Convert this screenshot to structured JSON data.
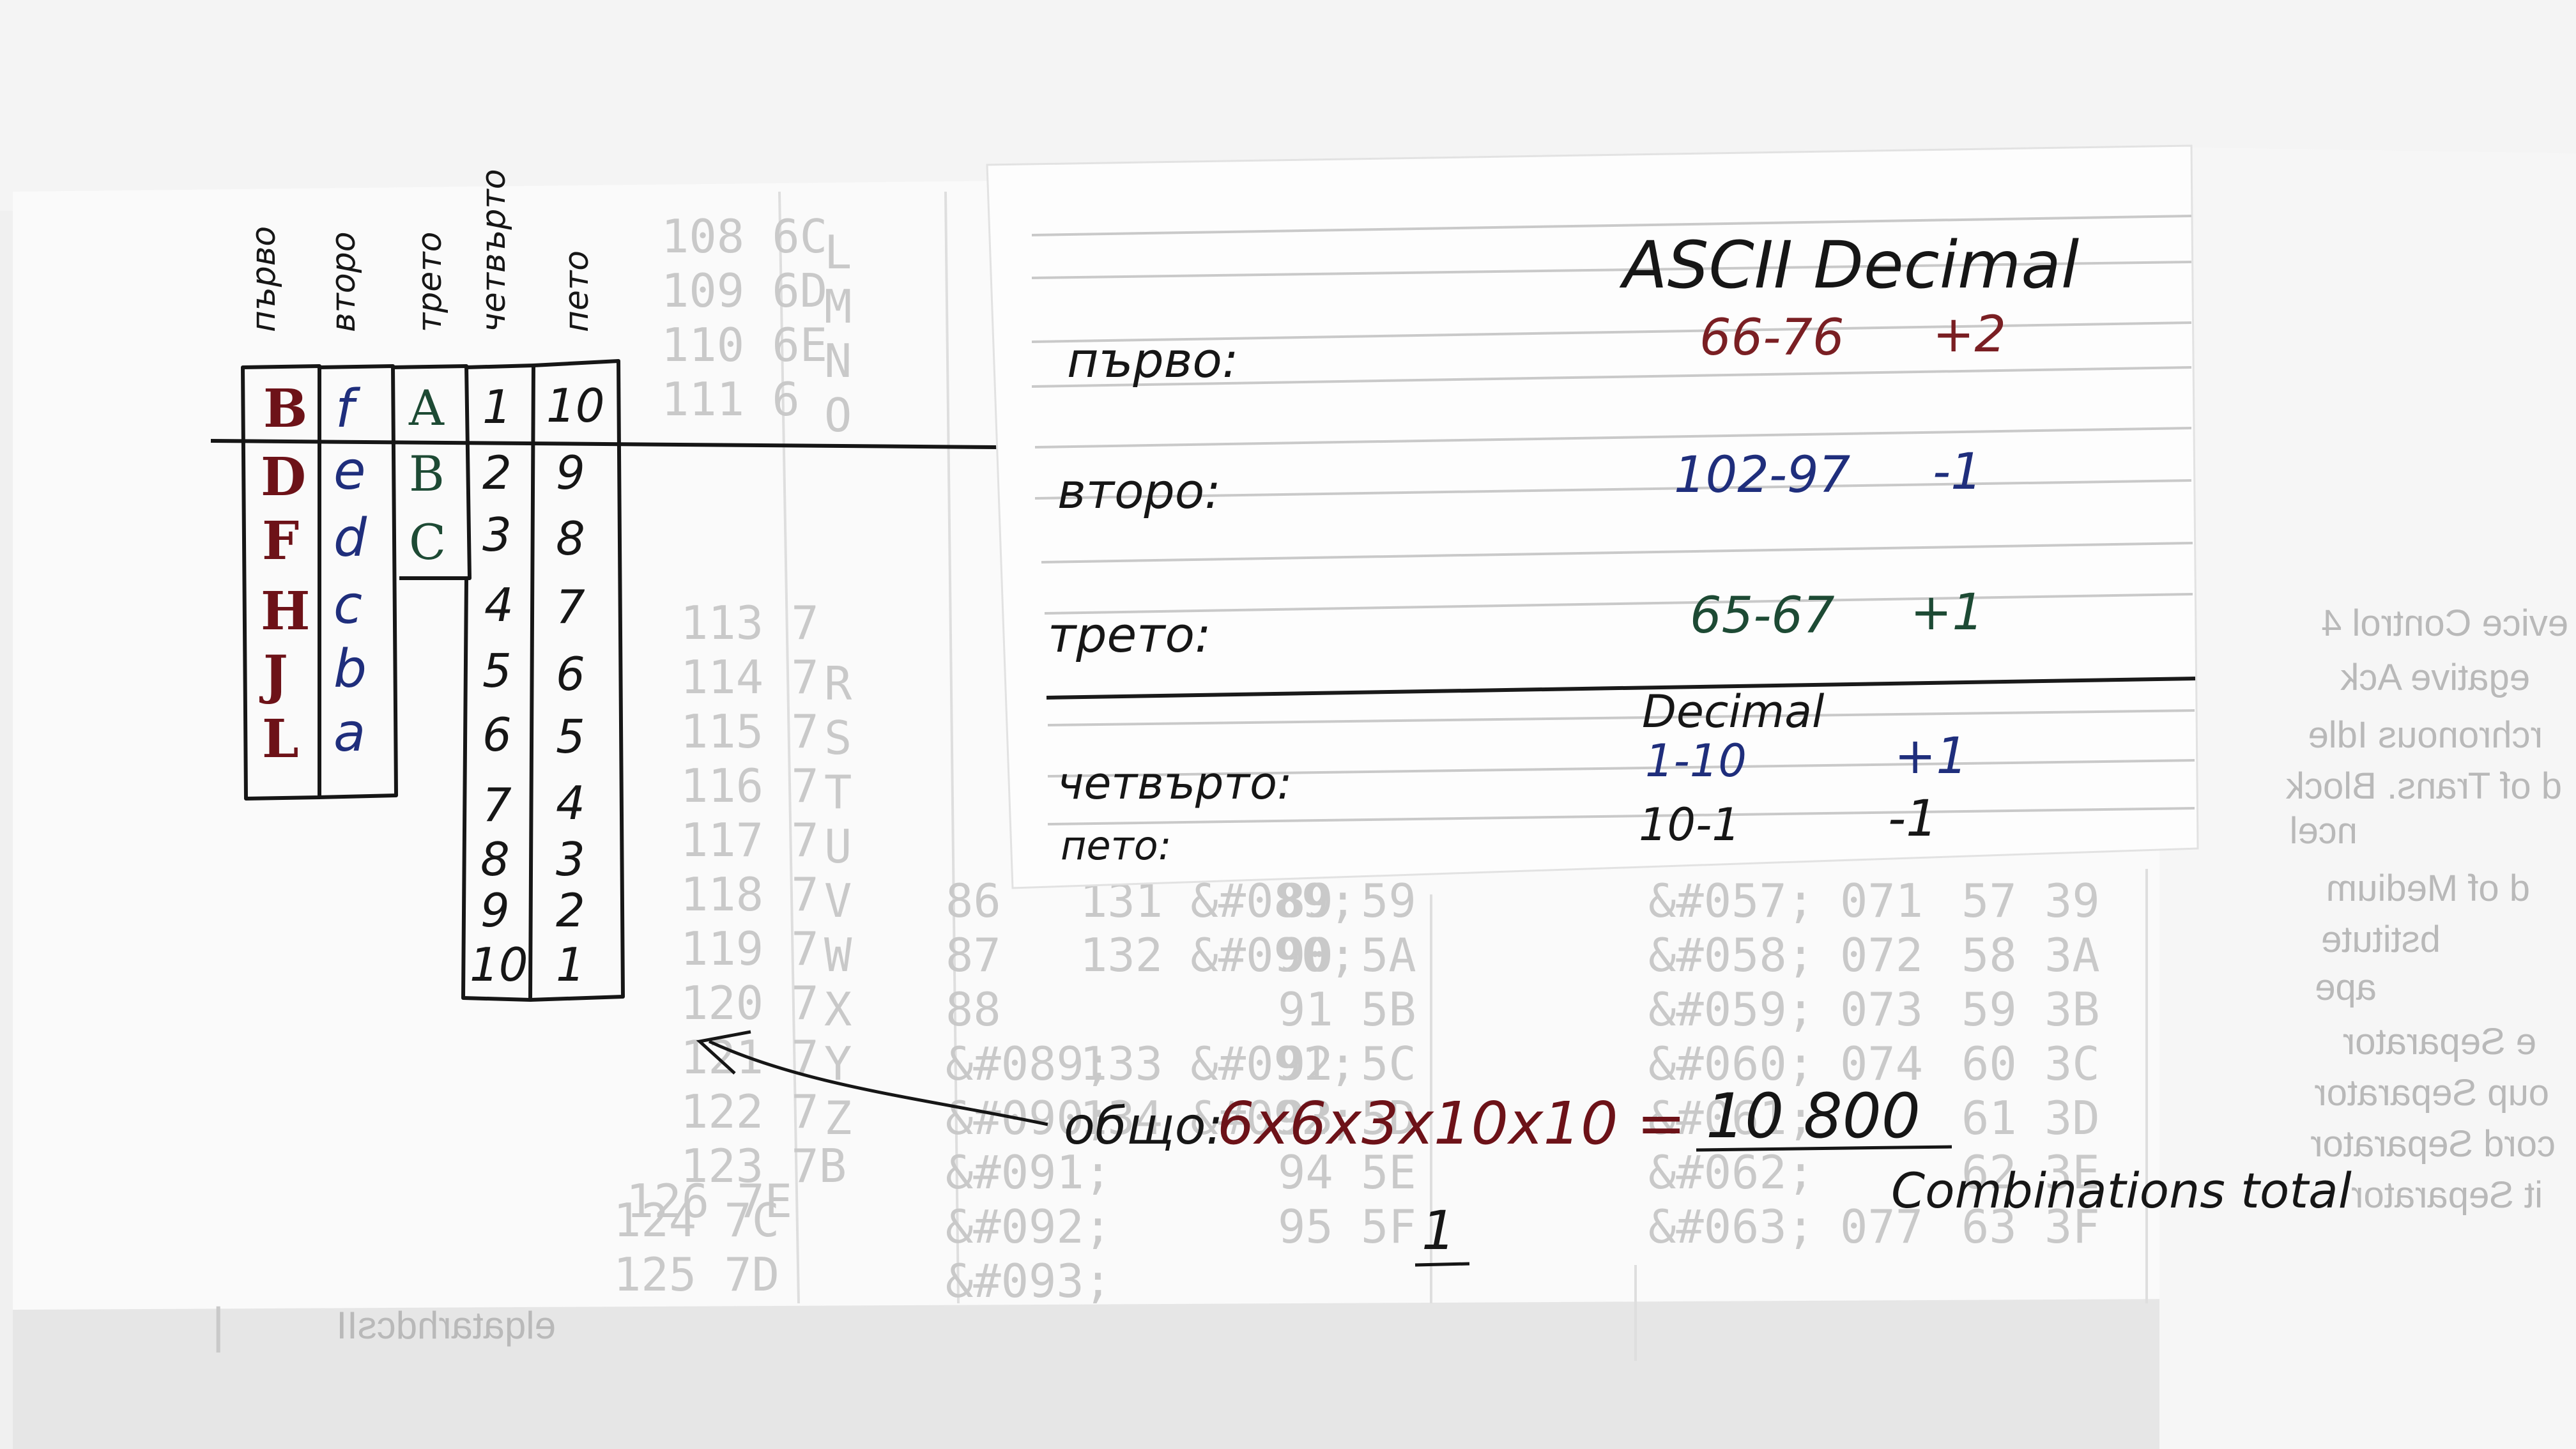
{
  "photo": {
    "colors": {
      "ink_black": "#161616",
      "ink_red": "#7a1f23",
      "ink_blue": "#1f2e7c",
      "ink_green": "#1d4a34",
      "paper": "#fbfbfb",
      "ghost_print": "#c9c9c9"
    }
  },
  "sheet": {
    "col_headers": [
      "първо",
      "второ",
      "трето",
      "четвърто",
      "пето"
    ],
    "col_first": [
      "B",
      "D",
      "F",
      "H",
      "J",
      "L"
    ],
    "col_second": [
      "f",
      "e",
      "d",
      "c",
      "b",
      "a"
    ],
    "col_third": [
      "A",
      "B",
      "C"
    ],
    "col_fourth": [
      "1",
      "2",
      "3",
      "4",
      "5",
      "6",
      "7",
      "8",
      "9",
      "10"
    ],
    "col_fifth": [
      "10",
      "9",
      "8",
      "7",
      "6",
      "5",
      "4",
      "3",
      "2",
      "1"
    ]
  },
  "card": {
    "heading": "ASCII Decimal",
    "subheading": "Decimal",
    "rows": [
      {
        "label": "първо:",
        "range": "66-76",
        "step": "+2"
      },
      {
        "label": "второ:",
        "range": "102-97",
        "step": "-1"
      },
      {
        "label": "трето:",
        "range": "65-67",
        "step": "+1"
      },
      {
        "label": "четвърто:",
        "range": "1-10",
        "step": "+1"
      },
      {
        "label": "пето:",
        "range": "10-1",
        "step": "-1"
      }
    ]
  },
  "formula": {
    "prefix": "общо:",
    "expression": "6x6x3x10x10 =",
    "total": "10 800",
    "caption": "Combinations total",
    "mark": "1"
  },
  "background": {
    "mirrored_lines": [
      "evice Control 4",
      "egative Ack"
    ],
    "footer_mirror": "elqatarhdcsII"
  }
}
